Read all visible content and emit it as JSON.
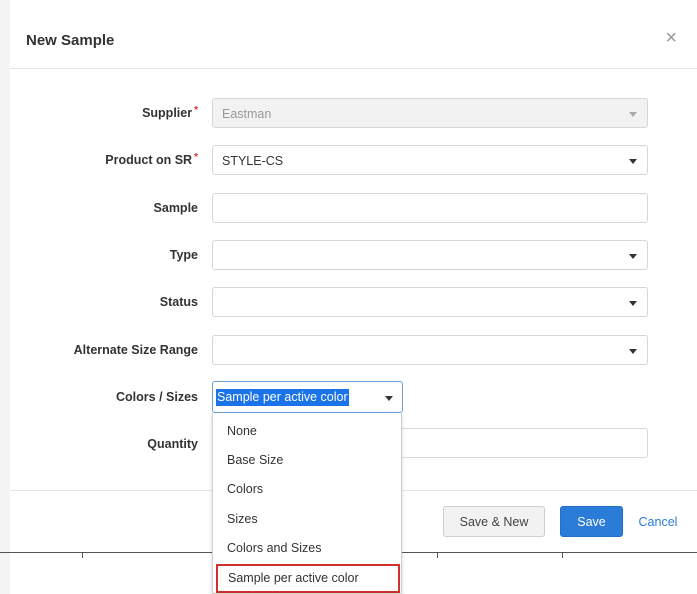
{
  "dialog": {
    "title": "New Sample",
    "close_glyph": "×"
  },
  "form": {
    "supplier": {
      "label": "Supplier",
      "required": "*",
      "value": "Eastman"
    },
    "product": {
      "label": "Product on SR",
      "required": "*",
      "value": "STYLE-CS"
    },
    "sample": {
      "label": "Sample",
      "value": ""
    },
    "type": {
      "label": "Type",
      "value": ""
    },
    "status": {
      "label": "Status",
      "value": ""
    },
    "alt_size_range": {
      "label": "Alternate Size Range",
      "value": ""
    },
    "colors_sizes": {
      "label": "Colors / Sizes",
      "value": "Sample per active color"
    },
    "quantity": {
      "label": "Quantity",
      "value": ""
    }
  },
  "dropdown": {
    "options": [
      "None",
      "Base Size",
      "Colors",
      "Sizes",
      "Colors and Sizes",
      "Sample per active color"
    ]
  },
  "footer": {
    "save_new": "Save & New",
    "save": "Save",
    "cancel": "Cancel"
  },
  "colors": {
    "primary": "#2b7bd9",
    "required": "#e0312f",
    "highlight_border": "#d0312d"
  }
}
